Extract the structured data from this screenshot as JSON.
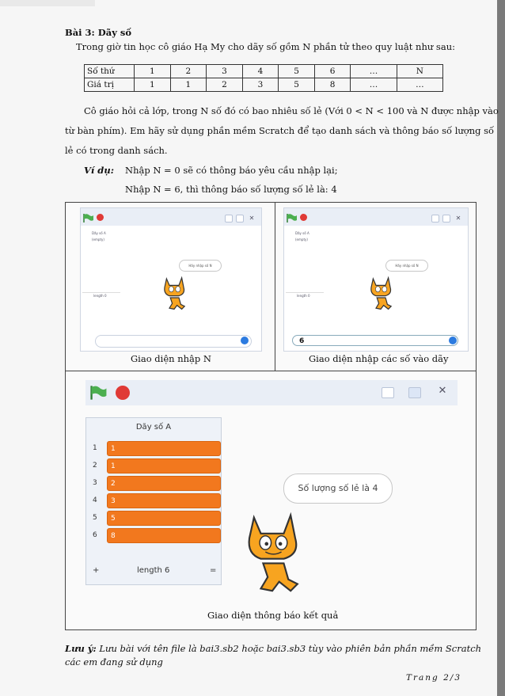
{
  "title": "Bài 3: Dãy số",
  "intro": "Trong giờ tin học cô giáo Hạ My cho dãy số gồm N phần tử theo quy luật như sau:",
  "table": {
    "row1": [
      "Số thứ",
      "1",
      "2",
      "3",
      "4",
      "5",
      "6",
      "…",
      "N"
    ],
    "row2": [
      "Giá trị",
      "1",
      "1",
      "2",
      "3",
      "5",
      "8",
      "…",
      "…"
    ]
  },
  "para1_line1": "Cô giáo hỏi cả lớp, trong N số đó có bao nhiêu số lẻ (Với 0 < N < 100 và N được nhập vào",
  "para1_line2": "từ bàn phím). Em hãy sử dụng phần mềm Scratch để tạo danh sách và thông báo số lượng số",
  "para1_line3": "lẻ có trong danh sách.",
  "example_label": "Ví dụ:",
  "example_line1": "Nhập N = 0 sẽ có thông báo yêu cầu nhập lại;",
  "example_line2": "Nhập N = 6, thì thông báo số lượng số lẻ là: 4",
  "panel1": {
    "list_title": "Dãy số A",
    "list_empty": "(empty)",
    "list_length": "length 0",
    "bubble": "Hãy nhập số N",
    "answer": "",
    "caption": "Giao diện nhập N"
  },
  "panel2": {
    "list_title": "Dãy số A",
    "list_empty": "(empty)",
    "list_length": "length 0",
    "bubble": "Hãy nhập số N",
    "answer": "6",
    "caption": "Giao diện nhập các số vào dãy"
  },
  "panel3": {
    "list_title": "Dãy số A",
    "items": [
      {
        "index": "1",
        "value": "1"
      },
      {
        "index": "2",
        "value": "1"
      },
      {
        "index": "3",
        "value": "2"
      },
      {
        "index": "4",
        "value": "3"
      },
      {
        "index": "5",
        "value": "5"
      },
      {
        "index": "6",
        "value": "8"
      }
    ],
    "plus": "+",
    "length": "length 6",
    "equals": "=",
    "bubble": "Số lượng số lẻ là 4",
    "caption": "Giao diện thông báo kết quả"
  },
  "note_label": "Lưu ý:",
  "note_line1": "Lưu bài với tên file là bai3.sb2 hoặc bai3.sb3 tùy vào phiên bản phần mềm Scratch",
  "note_line2": "các em đang sử dụng",
  "page_number": "Trang 2/3",
  "colors": {
    "orange": "#f2781e",
    "flag_green": "#4caf50",
    "stop_red": "#e03a36",
    "check_blue": "#2c7be0"
  },
  "icons": [
    "green-flag-icon",
    "stop-icon",
    "small-stage-icon",
    "normal-stage-icon",
    "fullscreen-icon",
    "check-icon",
    "scratch-cat"
  ]
}
